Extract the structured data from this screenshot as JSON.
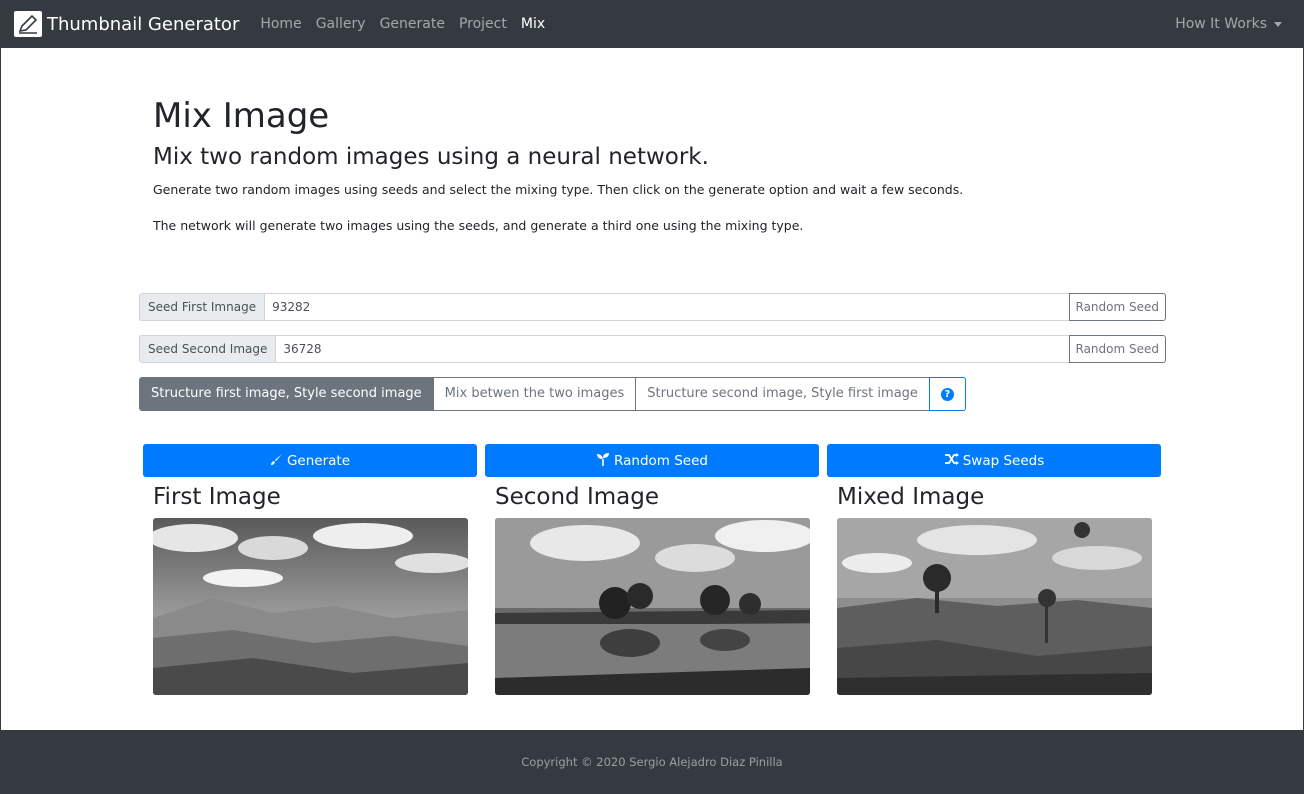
{
  "navbar": {
    "brand": "Thumbnail Generator",
    "links": [
      "Home",
      "Gallery",
      "Generate",
      "Project",
      "Mix"
    ],
    "active": "Mix",
    "dropdown": "How It Works"
  },
  "header": {
    "title": "Mix Image",
    "subtitle": "Mix two random images using a neural network.",
    "desc1": "Generate two random images using seeds and select the mixing type. Then click on the generate option and wait a few seconds.",
    "desc2": "The network will generate two images using the seeds, and generate a third one using the mixing type."
  },
  "seed1": {
    "label": "Seed First Imnage",
    "value": "93282",
    "button": "Random Seed"
  },
  "seed2": {
    "label": "Seed Second Image",
    "value": "36728",
    "button": "Random Seed"
  },
  "mix_types": {
    "options": [
      "Structure first image, Style second image",
      "Mix betwen the two images",
      "Structure second image, Style first image"
    ],
    "selected": "Structure first image, Style second image"
  },
  "actions": {
    "generate": "Generate",
    "random_seed": "Random Seed",
    "swap_seeds": "Swap Seeds"
  },
  "images": {
    "first": "First Image",
    "second": "Second Image",
    "mixed": "Mixed Image"
  },
  "footer": {
    "copyright": "Copyright © 2020 Sergio Alejadro Diaz Pinilla"
  },
  "colors": {
    "primary": "#007bff",
    "secondary": "#6c757d",
    "navbar": "#343a40"
  }
}
